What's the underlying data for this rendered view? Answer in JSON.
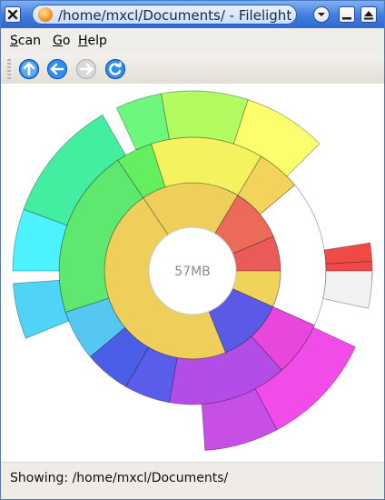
{
  "window": {
    "title": "/home/mxcl/Documents/ - Filelight"
  },
  "menu": {
    "scan_prefix": "S",
    "scan_rest": "can",
    "go_prefix": "G",
    "go_rest": "o",
    "help_prefix": "H",
    "help_rest": "elp"
  },
  "toolbar": {
    "buttons": [
      "up-icon",
      "back-icon",
      "forward-icon",
      "refresh-icon"
    ]
  },
  "chart": {
    "center_label": "57MB"
  },
  "status": {
    "text": "Showing: /home/mxcl/Documents/"
  }
}
